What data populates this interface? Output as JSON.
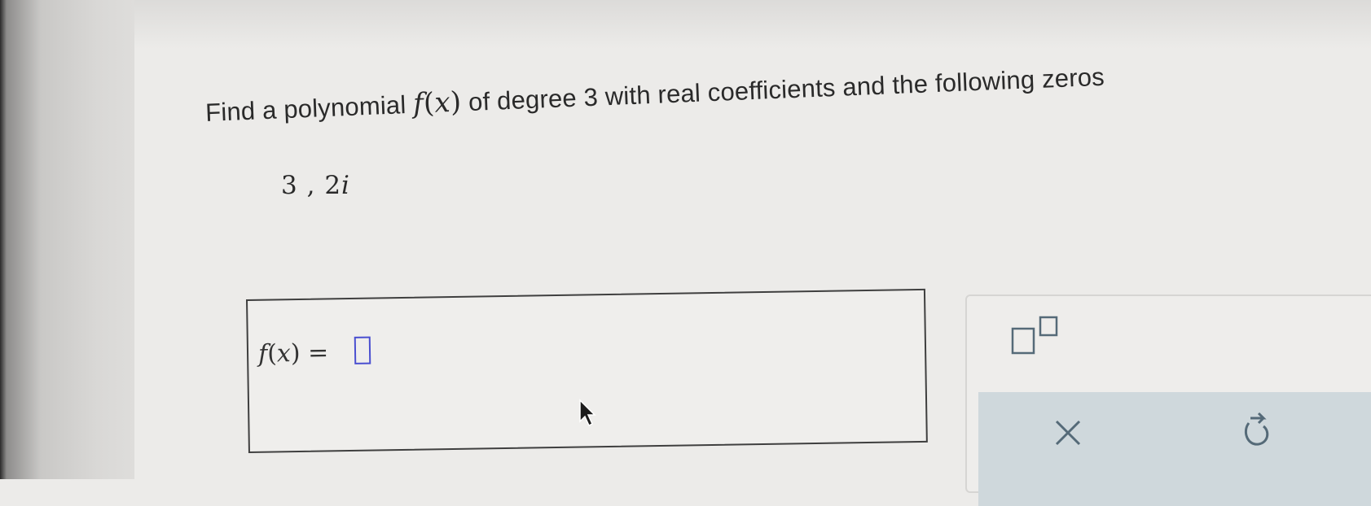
{
  "question": {
    "prefix": "Find a polynomial",
    "function_name": "f",
    "paren_open": "(",
    "variable": "x",
    "paren_close": ")",
    "suffix": "of degree 3 with real coefficients and the following zeros"
  },
  "zeros": {
    "first": "3",
    "separator": ",",
    "second_coefficient": "2",
    "second_unit": "i"
  },
  "answer": {
    "function_name": "f",
    "paren_open": "(",
    "variable": "x",
    "paren_close": ")",
    "equals": "=",
    "input_value": ""
  },
  "toolbar": {
    "exponent_icon": "exponent-template-icon",
    "clear_icon": "close-icon",
    "undo_icon": "undo-icon"
  },
  "colors": {
    "input_border": "#4a4fd0",
    "action_bar": "#cfd8dc",
    "icon": "#556a78"
  }
}
